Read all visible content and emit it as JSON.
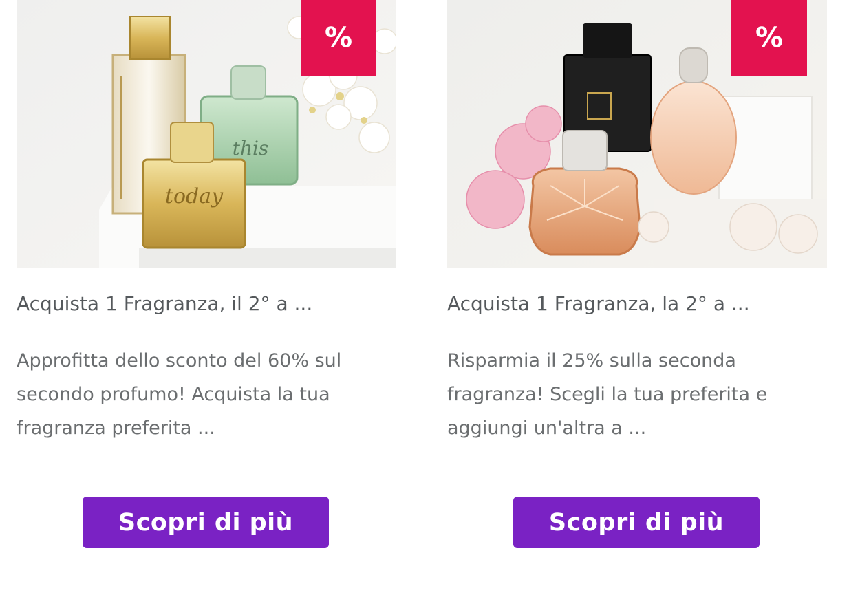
{
  "colors": {
    "badge": "#e3124f",
    "button": "#7a22c4",
    "title_text": "#55595c",
    "description_text": "#6b6e70"
  },
  "cards": [
    {
      "badge": "%",
      "title": "Acquista 1 Fragranza, il 2° a ...",
      "description": "Approfitta dello sconto del 60% sul secondo profumo! Acquista la tua fragranza preferita ...",
      "button_label": "Scopri di più",
      "image_logo_text": "today"
    },
    {
      "badge": "%",
      "title": "Acquista 1 Fragranza, la 2° a ...",
      "description": "Risparmia il 25% sulla seconda fragranza! Scegli la tua preferita e aggiungi un'altra a ...",
      "button_label": "Scopri di più",
      "image_logo_text": ""
    }
  ]
}
